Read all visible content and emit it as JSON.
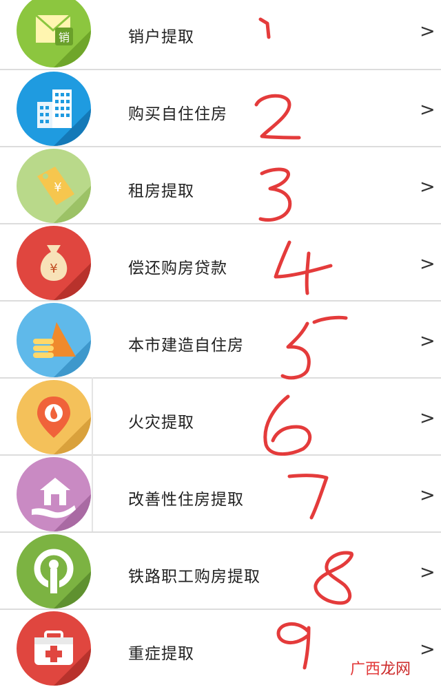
{
  "items": [
    {
      "label": "销户提取",
      "color": "#8cc63f"
    },
    {
      "label": "购买自住住房",
      "color": "#1f9be0"
    },
    {
      "label": "租房提取",
      "color": "#b9d98a"
    },
    {
      "label": "偿还购房贷款",
      "color": "#e0463f"
    },
    {
      "label": "本市建造自住房",
      "color": "#5fb9ea"
    },
    {
      "label": "火灾提取",
      "color": "#f4c15a"
    },
    {
      "label": "改善性住房提取",
      "color": "#c98ac3"
    },
    {
      "label": "铁路职工购房提取",
      "color": "#7cb342"
    },
    {
      "label": "重症提取",
      "color": "#e0463f"
    }
  ],
  "icon_texts": {
    "tag_symbol": "¥",
    "bag_symbol": "¥",
    "mail_text": "销"
  },
  "chevron": ">",
  "annotation_marks": [
    "1",
    "2",
    "3",
    "4",
    "5",
    "6",
    "7",
    "8",
    "9"
  ],
  "watermark": {
    "accent": "广西",
    "rest": "龙网"
  }
}
